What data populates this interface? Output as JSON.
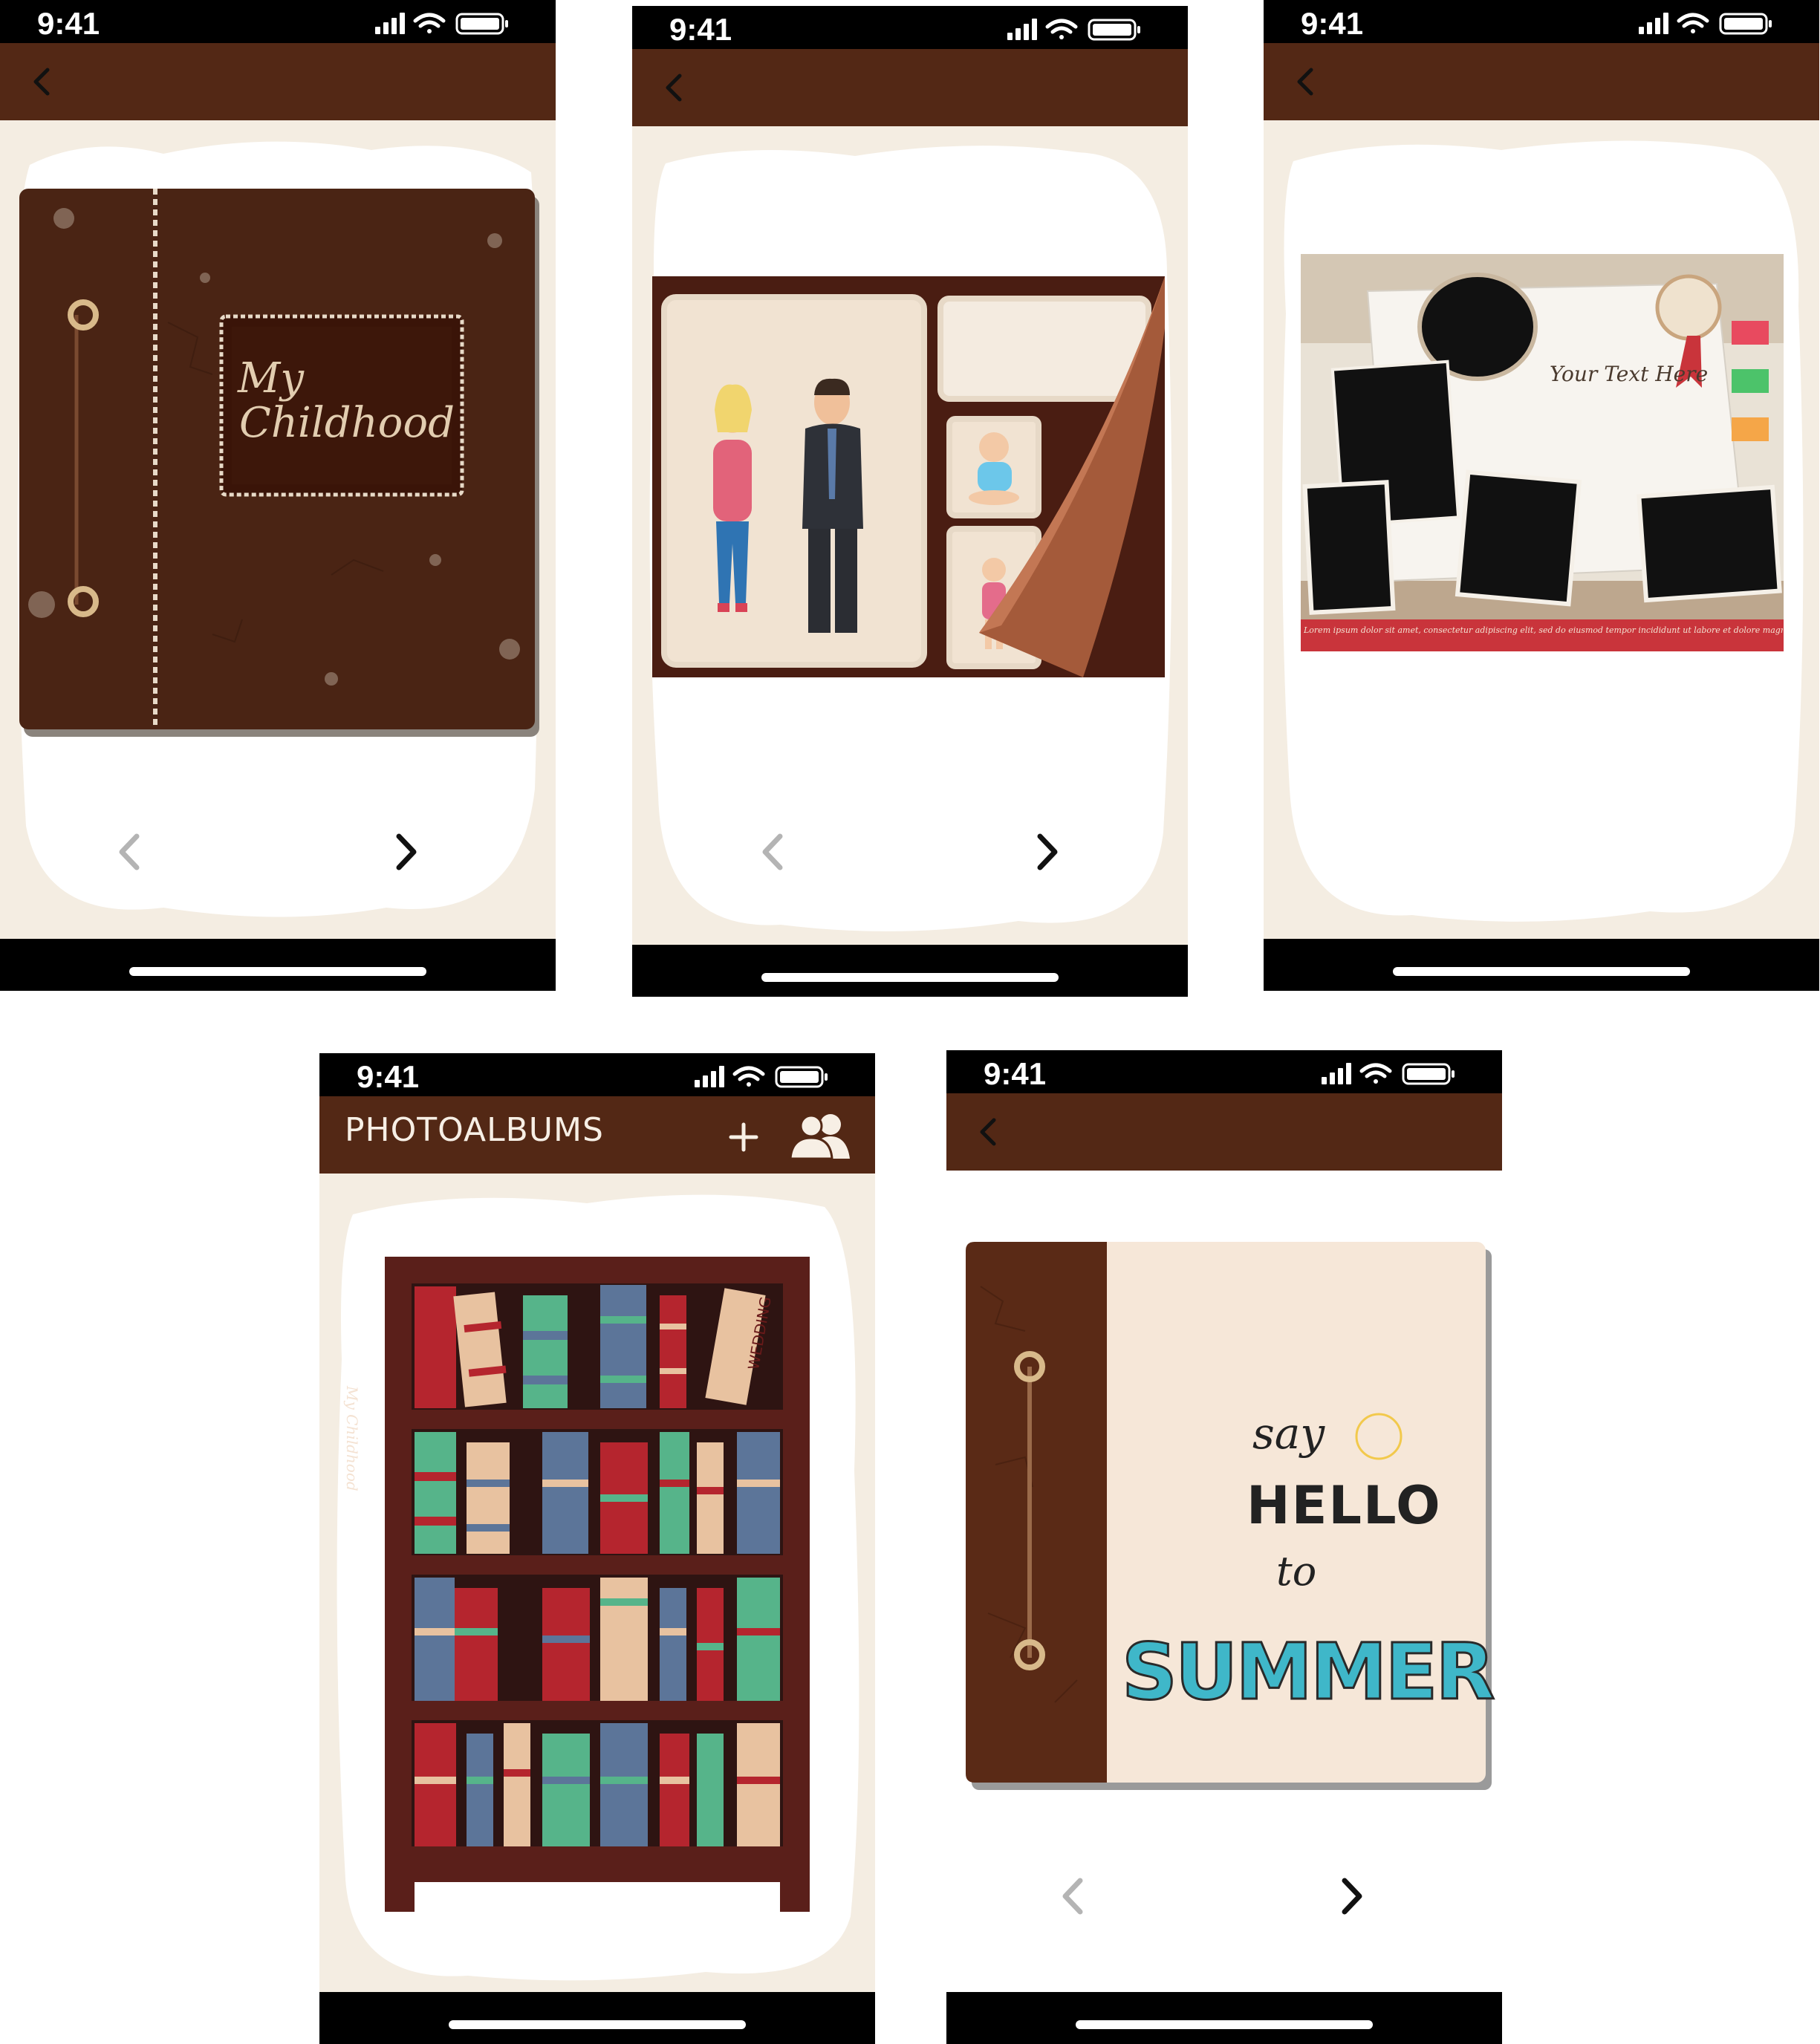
{
  "status_bar": {
    "time": "9:41"
  },
  "screens": {
    "album_cover": {
      "cover_title_line1": "My",
      "cover_title_line2": "Childhood"
    },
    "album_pages": {},
    "album_template": {
      "text_placeholder": "Your Text Here",
      "footer_lorem": "Lorem ipsum dolor sit amet, consectetur adipiscing elit, sed do eiusmod tempor incididunt ut labore et dolore magna aliqua"
    },
    "photoalbums": {
      "title": "PHOTOALBUMS",
      "spine_my_childhood": "My Childhood",
      "spine_wedding": "WEDDING"
    },
    "summer_album": {
      "line_say": "say",
      "line_hello": "HELLO",
      "line_to": "to",
      "line_summer": "SUMMER"
    }
  },
  "icons": {
    "back": "chevron-left-icon",
    "prev": "chevron-left-icon",
    "next": "chevron-right-icon",
    "add": "plus-icon",
    "friends": "users-icon",
    "signal": "signal-icon",
    "wifi": "wifi-icon",
    "battery": "battery-icon"
  },
  "colors": {
    "nav_brown": "#532815",
    "page_cream": "#f4ede2",
    "cover_brown": "#4a2414",
    "shelf_maroon": "#5a1f1a",
    "arrow_active": "#111111",
    "arrow_disabled": "#b4b4b4"
  },
  "navigation": {
    "prev_disabled": true,
    "next_enabled": true
  }
}
